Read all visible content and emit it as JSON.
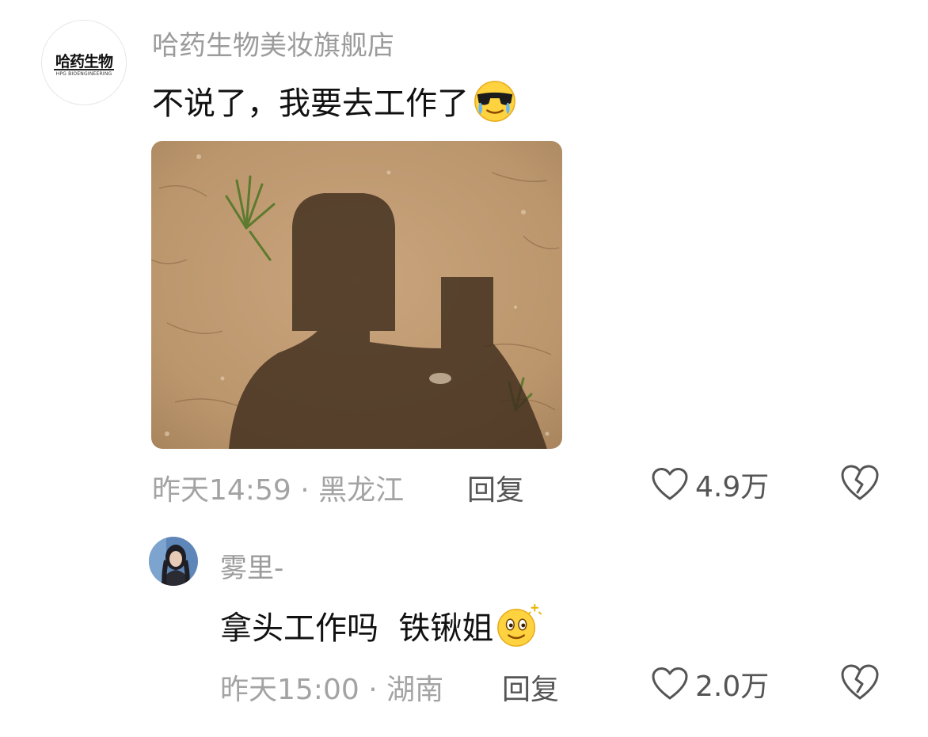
{
  "comment": {
    "avatar_logo": {
      "cn": "哈药生物",
      "en": "HPG BIOENGINEERING"
    },
    "username": "哈药生物美妆旗舰店",
    "text": "不说了，我要去工作了",
    "emoji": "cool-crying-emoji",
    "image": "shadow-selfie-on-dirt-photo",
    "time": "昨天14:59",
    "separator": " · ",
    "location": "黑龙江",
    "reply_label": "回复",
    "likes": "4.9万"
  },
  "reply": {
    "username": "雾里-",
    "text": "拿头工作吗  铁锹姐",
    "emoji": "sparkle-smile-emoji",
    "time": "昨天15:00",
    "separator": " · ",
    "location": "湖南",
    "reply_label": "回复",
    "likes": "2.0万"
  },
  "colors": {
    "muted_text": "#a3a3a3",
    "secondary_text": "#555555",
    "primary_text": "#111111"
  }
}
